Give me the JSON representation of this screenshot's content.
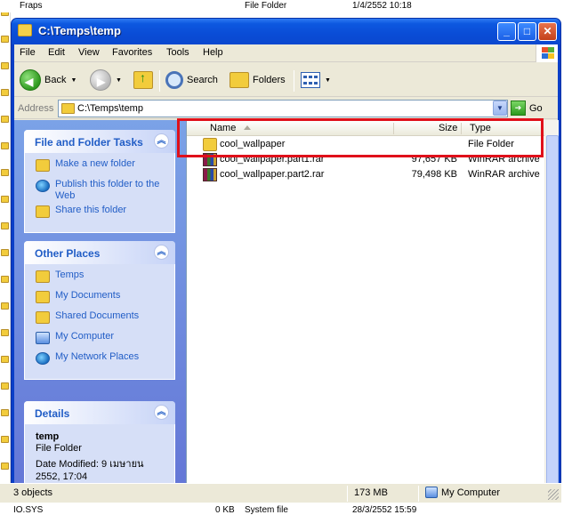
{
  "background": {
    "top_row": {
      "name": "Fraps",
      "type": "File Folder",
      "modified": "1/4/2552 10:18"
    },
    "bottom_row": {
      "name": "IO.SYS",
      "size": "0 KB",
      "type": "System file",
      "modified": "28/3/2552 15:59"
    }
  },
  "window": {
    "title": "C:\\Temps\\temp"
  },
  "menu": [
    "File",
    "Edit",
    "View",
    "Favorites",
    "Tools",
    "Help"
  ],
  "toolbar": {
    "back": "Back",
    "search": "Search",
    "folders": "Folders"
  },
  "address": {
    "label": "Address",
    "path": "C:\\Temps\\temp",
    "go": "Go"
  },
  "taskpane": {
    "file_tasks": {
      "title": "File and Folder Tasks",
      "items": [
        "Make a new folder",
        "Publish this folder to the Web",
        "Share this folder"
      ]
    },
    "other_places": {
      "title": "Other Places",
      "items": [
        "Temps",
        "My Documents",
        "Shared Documents",
        "My Computer",
        "My Network Places"
      ]
    },
    "details": {
      "title": "Details",
      "name": "temp",
      "type": "File Folder",
      "modified": "Date Modified: 9 เมษายน 2552, 17:04"
    }
  },
  "columns": {
    "name": "Name",
    "size": "Size",
    "type": "Type"
  },
  "files": [
    {
      "name": "cool_wallpaper",
      "size": "",
      "type": "File Folder",
      "icon": "folder-icon"
    },
    {
      "name": "cool_wallpaper.part1.rar",
      "size": "97,657 KB",
      "type": "WinRAR archive",
      "icon": "rar-icon"
    },
    {
      "name": "cool_wallpaper.part2.rar",
      "size": "79,498 KB",
      "type": "WinRAR archive",
      "icon": "rar-icon"
    }
  ],
  "status": {
    "objects": "3 objects",
    "size": "173 MB",
    "location": "My Computer"
  },
  "colors": {
    "titlebar": "#0a4cd6",
    "link": "#215dc6",
    "highlight": "#e0101a",
    "taskpane": "#7ba2e7"
  }
}
